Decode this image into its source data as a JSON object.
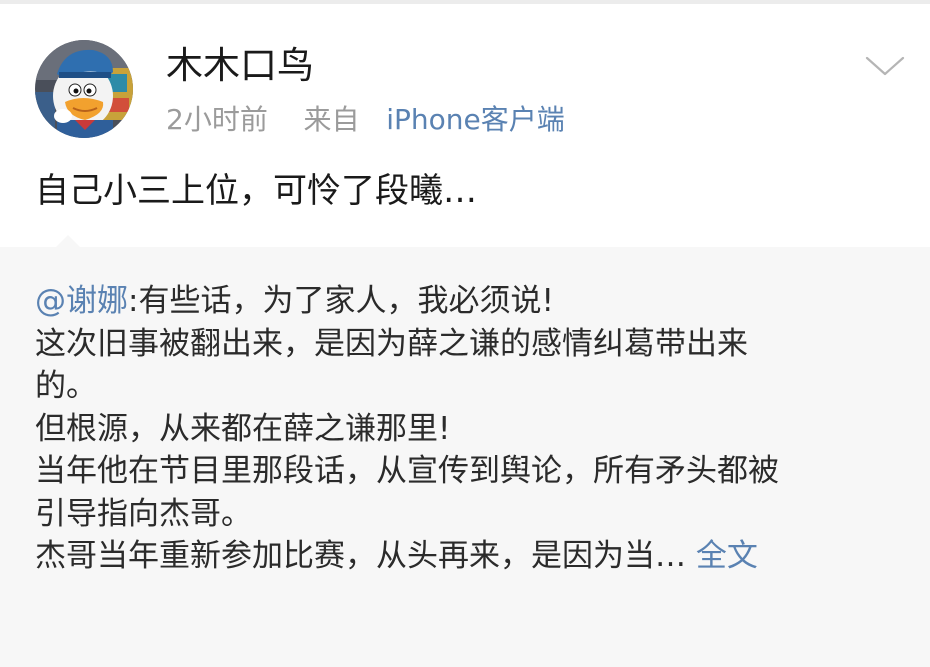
{
  "post": {
    "author": "木木口鸟",
    "time": "2小时前",
    "source_prefix": "来自",
    "source": "iPhone客户端",
    "text": "自己小三上位，可怜了段曦…",
    "avatar_icon": "avatar-donald-duck",
    "menu_icon": "chevron-down-icon"
  },
  "repost": {
    "mention": "@谢娜",
    "lines": [
      ":有些话，为了家人，我必须说!",
      "这次旧事被翻出来，是因为薛之谦的感情纠葛带出来",
      "的。",
      "但根源，从来都在薛之谦那里!",
      "当年他在节目里那段话，从宣传到舆论，所有矛头都被",
      "引导指向杰哥。",
      "杰哥当年重新参加比赛，从头再来，是因为当…"
    ],
    "more_label": "全文"
  },
  "colors": {
    "link": "#5a82b2",
    "meta": "#9b9b9b",
    "text": "#1a1a1a",
    "repost_bg": "#f7f7f7"
  }
}
